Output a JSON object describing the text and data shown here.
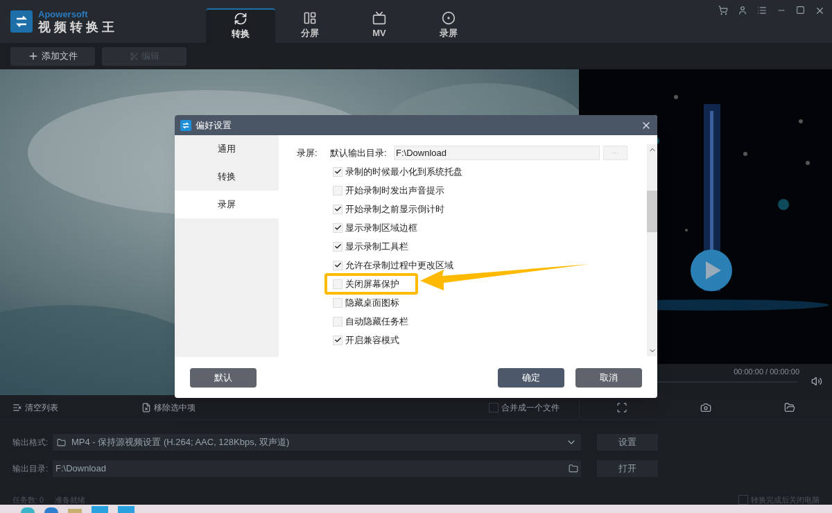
{
  "app": {
    "brand": "Apowersoft",
    "title": "视 频 转 换 王"
  },
  "tabs": [
    {
      "label": "转换",
      "selected": true
    },
    {
      "label": "分屏",
      "selected": false
    },
    {
      "label": "MV",
      "selected": false
    },
    {
      "label": "录屏",
      "selected": false
    }
  ],
  "toolbar": [
    {
      "label": "添加文件",
      "disabled": false
    },
    {
      "label": "编辑",
      "disabled": true
    }
  ],
  "dialog": {
    "title": "偏好设置",
    "nav": [
      {
        "label": "通用",
        "selected": false
      },
      {
        "label": "转换",
        "selected": false
      },
      {
        "label": "录屏",
        "selected": true
      }
    ],
    "section": "录屏:",
    "dir_label": "默认输出目录:",
    "dir_value": "F:\\Download",
    "browse": "···",
    "options": [
      {
        "label": "录制的时候最小化到系统托盘",
        "checked": true,
        "annotated": false
      },
      {
        "label": "开始录制时发出声音提示",
        "checked": false,
        "annotated": false
      },
      {
        "label": "开始录制之前显示倒计时",
        "checked": true,
        "annotated": false
      },
      {
        "label": "显示录制区域边框",
        "checked": true,
        "annotated": false
      },
      {
        "label": "显示录制工具栏",
        "checked": true,
        "annotated": false
      },
      {
        "label": "允许在录制过程中更改区域",
        "checked": true,
        "annotated": false
      },
      {
        "label": "关闭屏幕保护",
        "checked": false,
        "annotated": true
      },
      {
        "label": "隐藏桌面图标",
        "checked": false,
        "annotated": false
      },
      {
        "label": "自动隐藏任务栏",
        "checked": false,
        "annotated": false
      },
      {
        "label": "开启兼容模式",
        "checked": true,
        "annotated": false
      }
    ],
    "buttons": {
      "default": "默认",
      "ok": "确定",
      "cancel": "取消"
    }
  },
  "player": {
    "time": "00:00:00 / 00:00:00"
  },
  "list_actions": {
    "clear": "清空列表",
    "remove": "移除选中项",
    "merge": {
      "label": "合并成一个文件",
      "checked": false
    }
  },
  "output": {
    "format_label": "输出格式:",
    "format_value": "MP4 - 保持源视频设置 (H.264; AAC, 128Kbps, 双声道)",
    "settings": "设置",
    "dir_label": "输出目录:",
    "dir_value": "F:\\Download",
    "open": "打开"
  },
  "status": {
    "tasks": "任务数: 0",
    "state": "准备就绪",
    "shutdown": {
      "label": "转换完成后关闭电脑",
      "checked": false
    }
  }
}
